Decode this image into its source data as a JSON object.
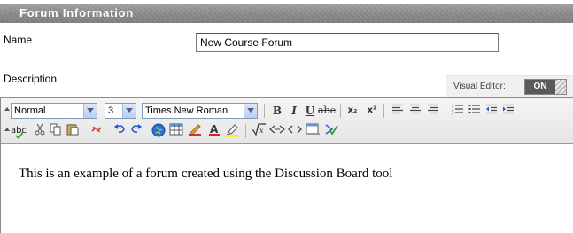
{
  "section": {
    "title": "Forum Information"
  },
  "name_field": {
    "label": "Name",
    "value": "New Course Forum"
  },
  "description": {
    "label": "Description"
  },
  "visual_editor": {
    "label": "Visual Editor:",
    "state": "ON"
  },
  "toolbar": {
    "format": "Normal",
    "size": "3",
    "font": "Times New Roman",
    "row1_icons": [
      "bold-icon",
      "italic-icon",
      "underline-icon",
      "strikethrough-icon",
      "subscript-icon",
      "superscript-icon",
      "align-left-icon",
      "align-center-icon",
      "align-right-icon",
      "numbered-list-icon",
      "bulleted-list-icon",
      "outdent-icon",
      "indent-icon"
    ],
    "row2_icons": [
      "spellcheck-icon",
      "cut-icon",
      "copy-icon",
      "paste-icon",
      "unlink-icon",
      "undo-icon",
      "redo-icon",
      "web-link-icon",
      "table-icon",
      "draw-icon",
      "text-color-icon",
      "highlight-icon",
      "math-equation-icon",
      "embed-icon",
      "html-source-icon",
      "preview-icon",
      "spellcheck-done-icon"
    ],
    "glyphs": {
      "bold": "B",
      "italic": "I",
      "underline": "U",
      "strike": "abe",
      "subscript": "x₂",
      "superscript": "x²",
      "spell": "abc"
    }
  },
  "editor": {
    "content": "This is an example of a forum created using the Discussion Board tool"
  },
  "colors": {
    "header_bg": "#8c8c8c",
    "toggle_on": "#5a5a5a",
    "link_blue": "#1a56c4"
  }
}
